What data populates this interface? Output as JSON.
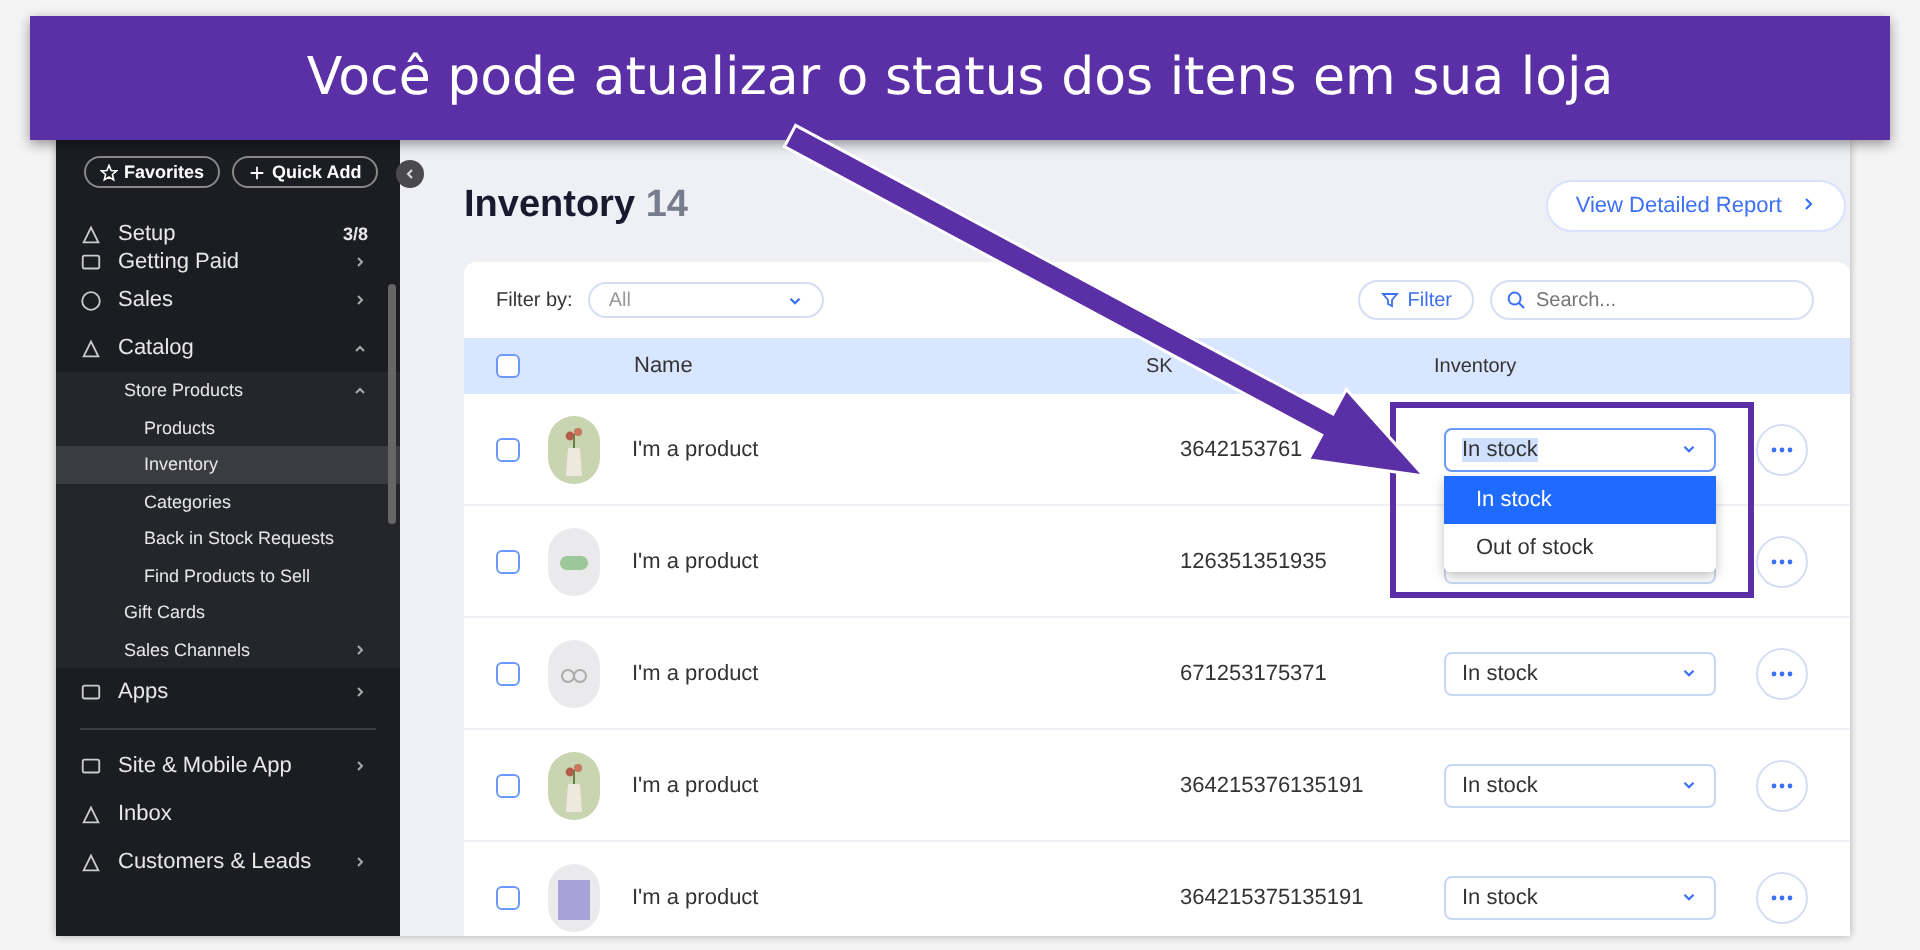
{
  "banner": {
    "title": "Você pode atualizar o status dos itens em sua loja"
  },
  "sidebar": {
    "top_buttons": [
      "Favorites",
      "Quick Add"
    ],
    "items": [
      {
        "label": "Setup",
        "badge": "3/8"
      },
      {
        "label": "Getting Paid",
        "expanded": false
      },
      {
        "label": "Sales",
        "expanded": false
      },
      {
        "label": "Catalog",
        "expanded": true,
        "children": [
          {
            "label": "Store Products",
            "expanded": true,
            "children": [
              {
                "label": "Products",
                "selected": false
              },
              {
                "label": "Inventory",
                "selected": true
              },
              {
                "label": "Categories",
                "selected": false
              },
              {
                "label": "Back in Stock Requests",
                "selected": false
              },
              {
                "label": "Find Products to Sell",
                "selected": false
              }
            ]
          },
          {
            "label": "Gift Cards"
          },
          {
            "label": "Sales Channels",
            "expanded": false
          }
        ]
      },
      {
        "label": "Apps",
        "expanded": false,
        "divider_after": true
      },
      {
        "label": "Site & Mobile App",
        "expanded": false
      },
      {
        "label": "Inbox"
      },
      {
        "label": "Customers & Leads",
        "expanded": false
      }
    ]
  },
  "page": {
    "title": "Inventory",
    "count": "14",
    "report_button": "View Detailed Report"
  },
  "select_all_checked": false,
  "toolbar": {
    "filter_label": "Filter by:",
    "filter_value": "All",
    "filter_button": "Filter",
    "search_placeholder": "Search..."
  },
  "table": {
    "columns": [
      "Name",
      "SK",
      "Inventory"
    ],
    "rows": [
      {
        "name": "I'm a product",
        "sku": "3642153761",
        "inventory": "In stock",
        "checked": false,
        "open": true
      },
      {
        "name": "I'm a product",
        "sku": "126351351935",
        "checked": false,
        "open": false
      },
      {
        "name": "I'm a product",
        "sku": "671253175371",
        "inventory": "In stock",
        "checked": false,
        "open": false
      },
      {
        "name": "I'm a product",
        "sku": "364215376135191",
        "inventory": "In stock",
        "checked": false,
        "open": false
      },
      {
        "name": "I'm a product",
        "sku": "364215375135191",
        "inventory": "In stock",
        "checked": false,
        "open": false
      }
    ],
    "dropdown_options": [
      {
        "label": "In stock",
        "selected": true
      },
      {
        "label": "Out of stock",
        "selected": false
      }
    ]
  }
}
